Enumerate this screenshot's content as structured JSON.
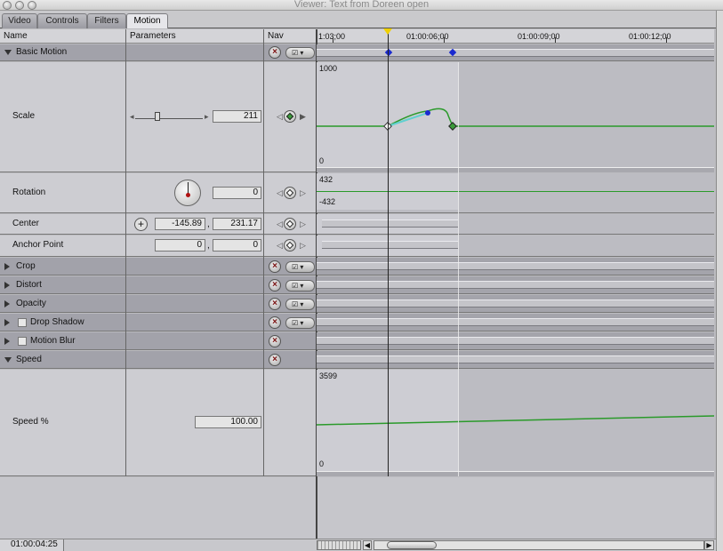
{
  "window": {
    "title": "Viewer: Text from Doreen open"
  },
  "tabs": [
    "Video",
    "Controls",
    "Filters",
    "Motion"
  ],
  "columns": {
    "name": "Name",
    "parameters": "Parameters",
    "nav": "Nav"
  },
  "timeline": {
    "ruler": [
      "1:03;00",
      "01:00:06;00",
      "01:00:09;00",
      "01:00:12;00"
    ]
  },
  "sections": {
    "basic_motion": "Basic Motion",
    "crop": "Crop",
    "distort": "Distort",
    "opacity": "Opacity",
    "drop_shadow": "Drop Shadow",
    "motion_blur": "Motion Blur",
    "speed": "Speed"
  },
  "params": {
    "scale": {
      "label": "Scale",
      "value": "211",
      "graph_max": "1000",
      "graph_min": "0",
      "slider_fraction": 0.33
    },
    "rotation": {
      "label": "Rotation",
      "value": "0",
      "graph_max": "432",
      "graph_min": "-432"
    },
    "center": {
      "label": "Center",
      "x": "-145.89",
      "y": "231.17",
      "separator": ","
    },
    "anchor_point": {
      "label": "Anchor Point",
      "x": "0",
      "y": "0",
      "separator": ","
    },
    "speed_percent": {
      "label": "Speed %",
      "value": "100.00",
      "graph_max": "3599",
      "graph_min": "0"
    }
  },
  "icons": {
    "reset": "x-icon",
    "menu": "checkbox-menu-icon",
    "keyframe": "keyframe-diamond-icon",
    "add_point": "crosshair-icon",
    "dial": "rotation-dial-icon"
  },
  "status": {
    "timecode": "01:00:04:25"
  },
  "colors": {
    "curve": "#2a9a2a",
    "keyframe": "#1a2ad0",
    "playhead": "#f0d000",
    "selection": "#60d0d0"
  }
}
